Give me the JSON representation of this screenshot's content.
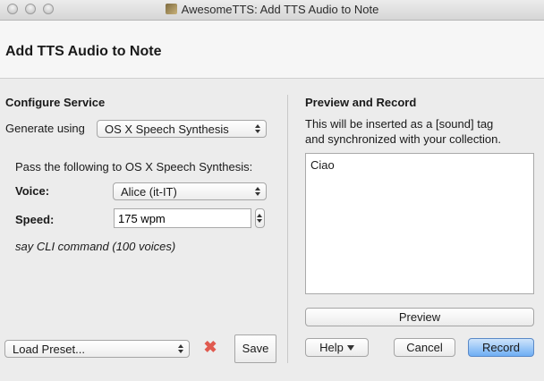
{
  "window": {
    "title": "AwesomeTTS: Add TTS Audio to Note"
  },
  "header": {
    "title": "Add TTS Audio to Note"
  },
  "configure": {
    "title": "Configure Service",
    "generate_label": "Generate using",
    "service_value": "OS X Speech Synthesis",
    "pass_text": "Pass the following to OS X Speech Synthesis:",
    "voice_label": "Voice:",
    "voice_value": "Alice (it-IT)",
    "speed_label": "Speed:",
    "speed_value": "175 wpm",
    "note": "say CLI command (100 voices)"
  },
  "preset": {
    "value": "Load Preset...",
    "save_label": "Save"
  },
  "preview": {
    "title": "Preview and Record",
    "desc_line1": "This will be inserted as a [sound] tag",
    "desc_line2": "and synchronized with your collection.",
    "text": "Ciao",
    "preview_label": "Preview"
  },
  "actions": {
    "help_label": "Help",
    "cancel_label": "Cancel",
    "record_label": "Record"
  },
  "colors": {
    "accent": "#6eaef4",
    "delete": "#e05a4f"
  },
  "icons": {
    "app": "awesometts-app-icon",
    "delete": "delete-x-icon"
  }
}
